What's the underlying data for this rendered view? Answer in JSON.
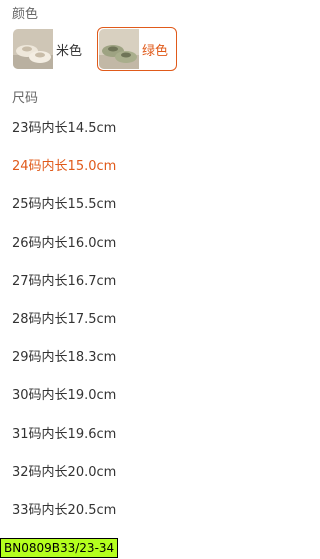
{
  "colors": {
    "label": "颜色",
    "options": [
      {
        "name": "米色",
        "selected": false
      },
      {
        "name": "绿色",
        "selected": true
      }
    ],
    "accent": "#e05a1a"
  },
  "sizes": {
    "label": "尺码",
    "items": [
      {
        "label": "23码内长14.5cm",
        "selected": false
      },
      {
        "label": "24码内长15.0cm",
        "selected": true
      },
      {
        "label": "25码内长15.5cm",
        "selected": false
      },
      {
        "label": "26码内长16.0cm",
        "selected": false
      },
      {
        "label": "27码内长16.7cm",
        "selected": false
      },
      {
        "label": "28码内长17.5cm",
        "selected": false
      },
      {
        "label": "29码内长18.3cm",
        "selected": false
      },
      {
        "label": "30码内长19.0cm",
        "selected": false
      },
      {
        "label": "31码内长19.6cm",
        "selected": false
      },
      {
        "label": "32码内长20.0cm",
        "selected": false
      },
      {
        "label": "33码内长20.5cm",
        "selected": false
      }
    ]
  },
  "overlay_tag": "BN0809B33/23-34"
}
